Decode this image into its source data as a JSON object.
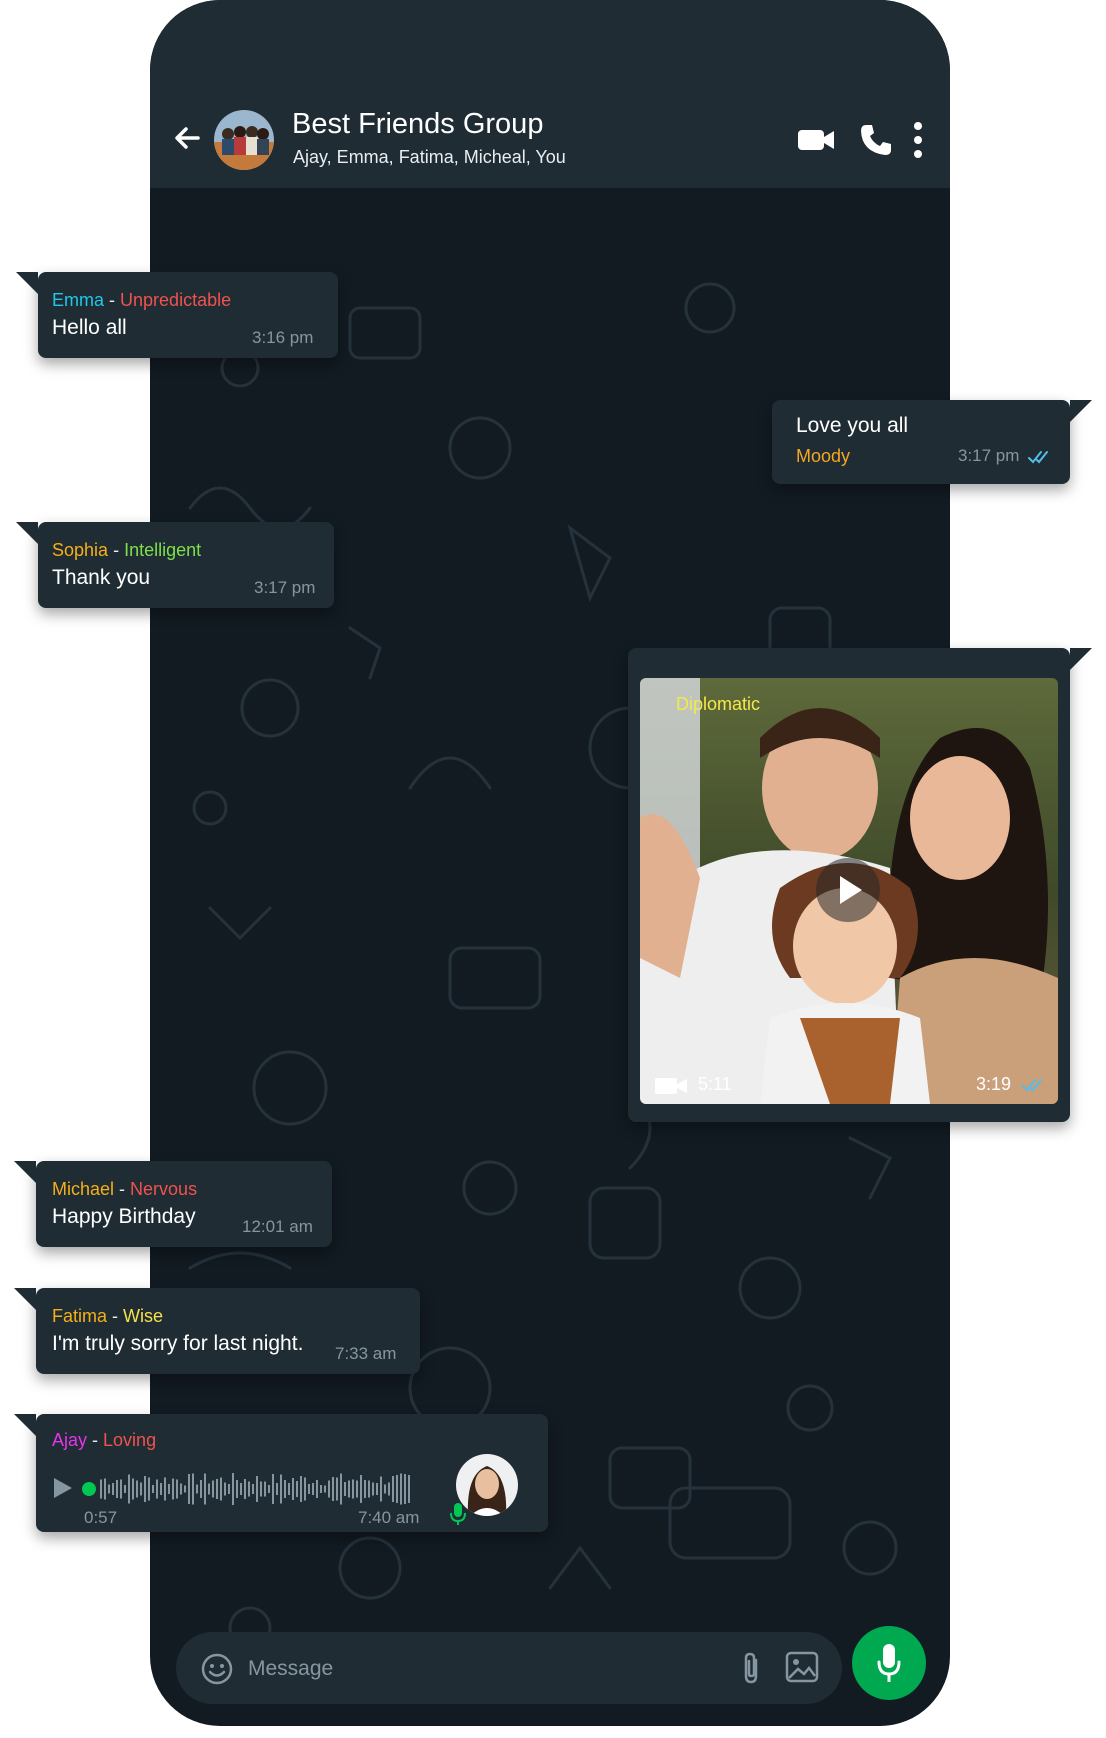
{
  "header": {
    "title": "Best Friends Group",
    "members": "Ajay, Emma, Fatima, Micheal, You",
    "icons": [
      "back-arrow-icon",
      "video-call-icon",
      "phone-call-icon",
      "more-options-icon"
    ]
  },
  "colors": {
    "background": "#121b22",
    "bubble": "#1f2c34",
    "accent_green": "#00a84f",
    "read_tick": "#53bdeb",
    "emma": "#1ec8e8",
    "unpredictable": "#f0524e",
    "sophia": "#f5b017",
    "intelligent": "#7ee04b",
    "moody": "#f5a623",
    "diplomatic": "#f5e94a",
    "michael": "#f5b017",
    "nervous": "#f0524e",
    "fatima": "#f5b017",
    "wise": "#f5e04a",
    "ajay": "#e535e8",
    "loving": "#f0524e"
  },
  "messages": [
    {
      "sender": "Emma",
      "mood": "Unpredictable",
      "text": "Hello all",
      "time": "3:16 pm"
    },
    {
      "outgoing": true,
      "mood": "Moody",
      "text": "Love you all",
      "time": "3:17 pm"
    },
    {
      "sender": "Sophia",
      "mood": "Intelligent",
      "text": "Thank you",
      "time": "3:17 pm"
    },
    {
      "outgoing": true,
      "type": "video",
      "mood": "Diplomatic",
      "duration": "5:11",
      "time": "3:19"
    },
    {
      "sender": "Michael",
      "mood": "Nervous",
      "text": "Happy Birthday",
      "time": "12:01 am"
    },
    {
      "sender": "Fatima",
      "mood": "Wise",
      "text": "I'm truly sorry for last night.",
      "time": "7:33 am"
    },
    {
      "sender": "Ajay",
      "mood": "Loving",
      "type": "voice",
      "duration": "0:57",
      "time": "7:40 am"
    }
  ],
  "input": {
    "placeholder": "Message",
    "icons": [
      "emoji-icon",
      "attach-icon",
      "gallery-icon",
      "mic-icon"
    ]
  }
}
